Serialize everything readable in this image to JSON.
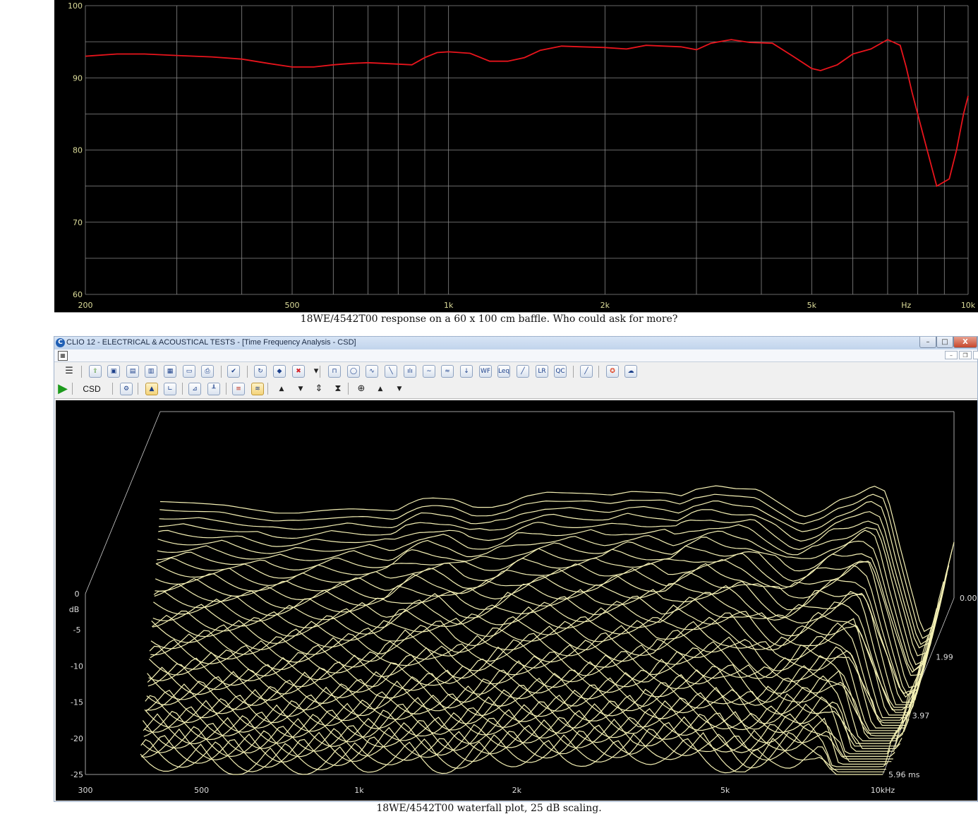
{
  "freq_chart": {
    "y_ticks": [
      "60",
      "70",
      "80",
      "90",
      "100"
    ],
    "x_ticks": [
      {
        "label": "200",
        "f": 200
      },
      {
        "label": "500",
        "f": 500
      },
      {
        "label": "1k",
        "f": 1000
      },
      {
        "label": "2k",
        "f": 2000
      },
      {
        "label": "5k",
        "f": 5000
      },
      {
        "label": "Hz",
        "f": 7600
      },
      {
        "label": "10k",
        "f": 10000
      }
    ],
    "line_color": "#e8141c"
  },
  "caption_top": "18WE/4542T00 response on a 60 x 100 cm baffle. Who could ask for more?",
  "caption_bottom": "18WE/4542T00 waterfall plot, 25 dB scaling.",
  "window": {
    "title": "CLIO 12 - ELECTRICAL & ACOUSTICAL TESTS - [Time Frequency Analysis - CSD]",
    "min_glyph": "–",
    "max_glyph": "□",
    "close_glyph": "X"
  },
  "toolbar1": {
    "icons": [
      {
        "name": "menu-icon",
        "glyph": "☰"
      },
      {
        "name": "open-folder-icon",
        "glyph": "⇪"
      },
      {
        "name": "save-icon",
        "glyph": "▣"
      },
      {
        "name": "save-as-icon",
        "glyph": "▤"
      },
      {
        "name": "export-icon",
        "glyph": "▥"
      },
      {
        "name": "export-image-icon",
        "glyph": "▦"
      },
      {
        "name": "notes-icon",
        "glyph": "▭"
      },
      {
        "name": "print-icon",
        "glyph": "⎙"
      },
      {
        "name": "checklist-icon",
        "glyph": "✔"
      },
      {
        "name": "refresh-icon",
        "glyph": "↻"
      },
      {
        "name": "eraser-icon",
        "glyph": "◆"
      },
      {
        "name": "delete-icon",
        "glyph": "✖"
      },
      {
        "name": "dropdown-arrow-icon",
        "glyph": "▾"
      },
      {
        "name": "signal-generator-icon",
        "glyph": "⊓"
      },
      {
        "name": "multimeter-icon",
        "glyph": "◯"
      },
      {
        "name": "oscilloscope-icon",
        "glyph": "∿"
      },
      {
        "name": "linear-icon",
        "glyph": "╲"
      },
      {
        "name": "fft-icon",
        "glyph": "ıIı"
      },
      {
        "name": "sinusoidal-icon",
        "glyph": "∼"
      },
      {
        "name": "mls-icon",
        "glyph": "≈"
      },
      {
        "name": "download-icon",
        "glyph": "↓"
      },
      {
        "name": "wf-icon",
        "glyph": "WF"
      },
      {
        "name": "leq-icon",
        "glyph": "Leq"
      },
      {
        "name": "slope-icon",
        "glyph": "╱"
      },
      {
        "name": "lr-icon",
        "glyph": "LR"
      },
      {
        "name": "qc-icon",
        "glyph": "QC"
      },
      {
        "name": "ruler-icon",
        "glyph": "╱"
      },
      {
        "name": "help-lifebuoy-icon",
        "glyph": "✪"
      },
      {
        "name": "cloud-info-icon",
        "glyph": "☁"
      }
    ]
  },
  "toolbar2": {
    "csd_label": "CSD",
    "icons": [
      {
        "name": "play-icon",
        "glyph": "▶"
      },
      {
        "name": "settings-icon",
        "glyph": "⚙"
      },
      {
        "name": "waterfall-3d-icon",
        "glyph": "▲"
      },
      {
        "name": "axes-icon",
        "glyph": "∟"
      },
      {
        "name": "chart-up-icon",
        "glyph": "⊿"
      },
      {
        "name": "chart-steps-icon",
        "glyph": "╨"
      },
      {
        "name": "color-scale-icon",
        "glyph": "≡"
      },
      {
        "name": "waterfall-lines-icon",
        "glyph": "≋"
      },
      {
        "name": "arrow-up-icon",
        "glyph": "▲"
      },
      {
        "name": "arrow-down-icon",
        "glyph": "▼"
      },
      {
        "name": "expand-vertical-icon",
        "glyph": "⇕"
      },
      {
        "name": "compress-vertical-icon",
        "glyph": "⧗"
      },
      {
        "name": "cursor-target-icon",
        "glyph": "⊕"
      },
      {
        "name": "arrow-up-icon-2",
        "glyph": "▲"
      },
      {
        "name": "arrow-down-icon-2",
        "glyph": "▼"
      }
    ]
  },
  "csd_chart": {
    "db_ticks": [
      {
        "label": "0",
        "db": 0
      },
      {
        "label": "-5",
        "db": -5
      },
      {
        "label": "-10",
        "db": -10
      },
      {
        "label": "-15",
        "db": -15
      },
      {
        "label": "-20",
        "db": -20
      },
      {
        "label": "-25",
        "db": -25
      }
    ],
    "db_unit": "dB",
    "freq_ticks": [
      {
        "label": "300",
        "f": 300
      },
      {
        "label": "500",
        "f": 500
      },
      {
        "label": "1k",
        "f": 1000
      },
      {
        "label": "2k",
        "f": 2000
      },
      {
        "label": "5k",
        "f": 5000
      },
      {
        "label": "10kHz",
        "f": 10000
      }
    ],
    "time_ticks": [
      {
        "label": "0.00",
        "t": 0.0
      },
      {
        "label": "1.99",
        "t": 1.99
      },
      {
        "label": "3.97",
        "t": 3.97
      },
      {
        "label": "5.96 ms",
        "t": 5.96
      }
    ],
    "line_color": "#f4f0b4"
  },
  "chart_data": [
    {
      "type": "line",
      "x_scale": "log",
      "xlim": [
        200,
        10000
      ],
      "ylim": [
        60,
        100
      ],
      "series": [
        {
          "x": [
            200,
            230,
            260,
            300,
            350,
            400,
            450,
            500,
            550,
            600,
            650,
            700,
            750,
            800,
            850,
            900,
            950,
            1000,
            1100,
            1200,
            1300,
            1400,
            1500,
            1650,
            1800,
            2000,
            2200,
            2400,
            2600,
            2800,
            3000,
            3200,
            3500,
            3800,
            4200,
            4600,
            5000,
            5200,
            5600,
            6000,
            6500,
            7000,
            7400,
            7600,
            7800,
            8200,
            8700,
            9200,
            9500,
            9800,
            10000
          ],
          "y": [
            93,
            93.3,
            93.3,
            93.1,
            92.9,
            92.6,
            92,
            91.5,
            91.5,
            91.8,
            92,
            92.1,
            92,
            91.9,
            91.8,
            92.8,
            93.5,
            93.6,
            93.4,
            92.3,
            92.3,
            92.8,
            93.8,
            94.4,
            94.3,
            94.2,
            94,
            94.5,
            94.4,
            94.3,
            93.9,
            94.8,
            95.3,
            94.9,
            94.8,
            93,
            91.3,
            91,
            91.8,
            93.3,
            94,
            95.3,
            94.5,
            91.5,
            88,
            82,
            75,
            76,
            80,
            85,
            87.5
          ]
        }
      ]
    },
    {
      "type": "area",
      "x_scale": "log",
      "xlim": [
        300,
        10000
      ],
      "ylim": [
        -25,
        0
      ],
      "time_range_ms": [
        0,
        5.96
      ],
      "series": []
    }
  ]
}
